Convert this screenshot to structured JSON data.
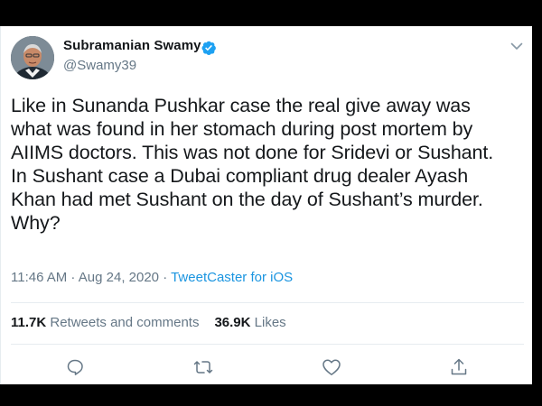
{
  "author": {
    "name": "Subramanian Swamy",
    "handle": "@Swamy39",
    "verified": true
  },
  "tweet": {
    "lines": [
      "Like in Sunanda Pushkar case the real give away was",
      "what was found in her stomach during post mortem by",
      "AIIMS doctors. This was not done for Sridevi or Sushant.",
      "In Sushant case a Dubai compliant drug dealer Ayash",
      "Khan had met Sushant on the day of Sushant’s murder.",
      "Why?"
    ]
  },
  "meta": {
    "time": "11:46 AM",
    "separator1": " · ",
    "date": "Aug 24, 2020",
    "separator2": " · ",
    "source": "TweetCaster for iOS"
  },
  "stats": {
    "retweets_count": "11.7K",
    "retweets_label": "Retweets and comments",
    "likes_count": "36.9K",
    "likes_label": "Likes"
  },
  "icons": {
    "verified": "verified-badge-icon",
    "caret": "chevron-down-icon",
    "reply": "reply-icon",
    "retweet": "retweet-icon",
    "like": "heart-icon",
    "share": "share-icon"
  },
  "colors": {
    "text": "#14171a",
    "secondary": "#657786",
    "link": "#1b95e0",
    "verified": "#1da1f2",
    "frame": "#000000"
  }
}
